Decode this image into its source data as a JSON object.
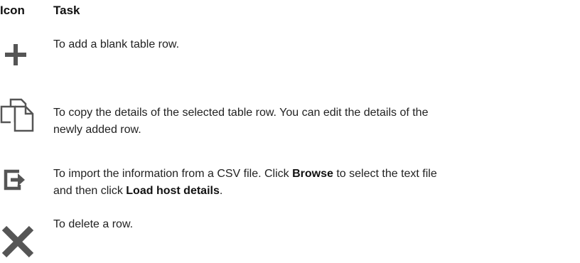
{
  "header": {
    "icon_col": "Icon",
    "task_col": "Task"
  },
  "rows": [
    {
      "icon": "plus-icon",
      "text": "To add a blank table row."
    },
    {
      "icon": "copy-icon",
      "line1": "To copy the details of the selected table row. You can edit the details of the",
      "line2": "newly added row."
    },
    {
      "icon": "import-icon",
      "pre": "To import the information from a CSV file. Click ",
      "bold1": "Browse",
      "mid": " to select the text file",
      "pre2": "and then click ",
      "bold2": "Load host details",
      "post": "."
    },
    {
      "icon": "delete-icon",
      "text": "To delete a row."
    }
  ],
  "colors": {
    "icon": "#555555",
    "text": "#222222"
  }
}
